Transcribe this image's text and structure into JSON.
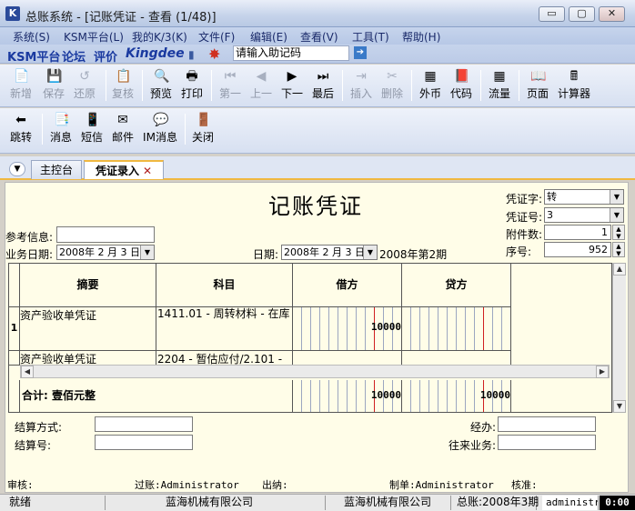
{
  "window": {
    "title": "总账系统 - [记账凭证 - 查看 (1/48)]",
    "app_icon_letter": "K",
    "minimize": "▭",
    "restore": "▢",
    "close": "✕"
  },
  "menu": [
    "系统(S)",
    "KSM平台(L)",
    "我的K/3(K)",
    "文件(F)",
    "编辑(E)",
    "查看(V)",
    "工具(T)",
    "帮助(H)"
  ],
  "brand": {
    "links": [
      "KSM平台",
      "论坛",
      "评价"
    ],
    "logo": "Kingdee",
    "mnemonic_placeholder": "请输入助记码"
  },
  "toolbar1": [
    {
      "label": "新增",
      "icon": "new-doc-icon",
      "glyph": "📄",
      "disabled": true
    },
    {
      "label": "保存",
      "icon": "save-icon",
      "glyph": "💾",
      "disabled": true
    },
    {
      "label": "还原",
      "icon": "restore-icon",
      "glyph": "↺",
      "disabled": true
    },
    {
      "label": "复核",
      "icon": "review-icon",
      "glyph": "📋",
      "disabled": true
    },
    {
      "label": "预览",
      "icon": "preview-icon",
      "glyph": "🔍",
      "disabled": false
    },
    {
      "label": "打印",
      "icon": "print-icon",
      "glyph": "🖶",
      "disabled": false
    },
    {
      "label": "第一",
      "icon": "first-icon",
      "glyph": "⏮",
      "disabled": true
    },
    {
      "label": "上一",
      "icon": "prev-icon",
      "glyph": "◀",
      "disabled": true
    },
    {
      "label": "下一",
      "icon": "next-icon",
      "glyph": "▶",
      "disabled": false
    },
    {
      "label": "最后",
      "icon": "last-icon",
      "glyph": "⏭",
      "disabled": false
    },
    {
      "label": "插入",
      "icon": "insert-icon",
      "glyph": "⇥",
      "disabled": true
    },
    {
      "label": "删除",
      "icon": "delete-icon",
      "glyph": "✂",
      "disabled": true
    },
    {
      "label": "外币",
      "icon": "currency-icon",
      "glyph": "▦",
      "disabled": false
    },
    {
      "label": "代码",
      "icon": "code-icon",
      "glyph": "📕",
      "disabled": false
    },
    {
      "label": "流量",
      "icon": "flow-icon",
      "glyph": "▦",
      "disabled": false
    },
    {
      "label": "页面",
      "icon": "page-icon",
      "glyph": "📖",
      "disabled": false
    },
    {
      "label": "计算器",
      "icon": "calculator-icon",
      "glyph": "🖩",
      "disabled": false
    }
  ],
  "toolbar2": [
    {
      "label": "跳转",
      "icon": "jump-icon",
      "glyph": "⬅"
    },
    {
      "label": "消息",
      "icon": "message-icon",
      "glyph": "📑"
    },
    {
      "label": "短信",
      "icon": "sms-icon",
      "glyph": "📱"
    },
    {
      "label": "邮件",
      "icon": "mail-icon",
      "glyph": "✉"
    },
    {
      "label": "IM消息",
      "icon": "im-icon",
      "glyph": "💬"
    },
    {
      "label": "关闭",
      "icon": "exit-icon",
      "glyph": "🚪"
    }
  ],
  "tabs": [
    {
      "label": "主控台",
      "active": false
    },
    {
      "label": "凭证录入",
      "active": true,
      "close": "✕"
    }
  ],
  "voucher": {
    "title": "记账凭证",
    "ref_label": "参考信息:",
    "ref_value": "",
    "biz_date_label": "业务日期:",
    "biz_date_value": "2008年 2 月 3 日",
    "date_label": "日期:",
    "date_value": "2008年 2 月 3 日",
    "period": "2008年第2期",
    "word_label": "凭证字:",
    "word_value": "转",
    "number_label": "凭证号:",
    "number_value": "3",
    "attach_label": "附件数:",
    "attach_value": "1",
    "seq_label": "序号:",
    "seq_value": "952"
  },
  "grid": {
    "headers": [
      "摘要",
      "科目",
      "借方",
      "贷方"
    ],
    "rows": [
      {
        "no": "1",
        "summary": "资产验收单凭证",
        "account": "1411.01 - 周转材料 - 在库",
        "debit": "10000",
        "credit": ""
      },
      {
        "no": "",
        "summary": "资产验收单凭证",
        "account": "2204 - 暂估应付/2.101 -",
        "debit": "",
        "credit": ""
      }
    ],
    "total_label": "合计: 壹佰元整",
    "total_debit": "10000",
    "total_credit": "10000"
  },
  "bottom": {
    "settle_method_label": "结算方式:",
    "settle_no_label": "结算号:",
    "handler_label": "经办:",
    "partner_label": "往来业务:"
  },
  "footer": {
    "audit": "审核:",
    "posted": "过账:Administrator",
    "cashier": "出纳:",
    "maker": "制单:Administrator",
    "approve": "核准:"
  },
  "status": {
    "ready": "就绪",
    "company1": "蓝海机械有限公司",
    "company2": "蓝海机械有限公司",
    "period": "总账:2008年3期",
    "user": "administra",
    "clock": "0:00"
  }
}
